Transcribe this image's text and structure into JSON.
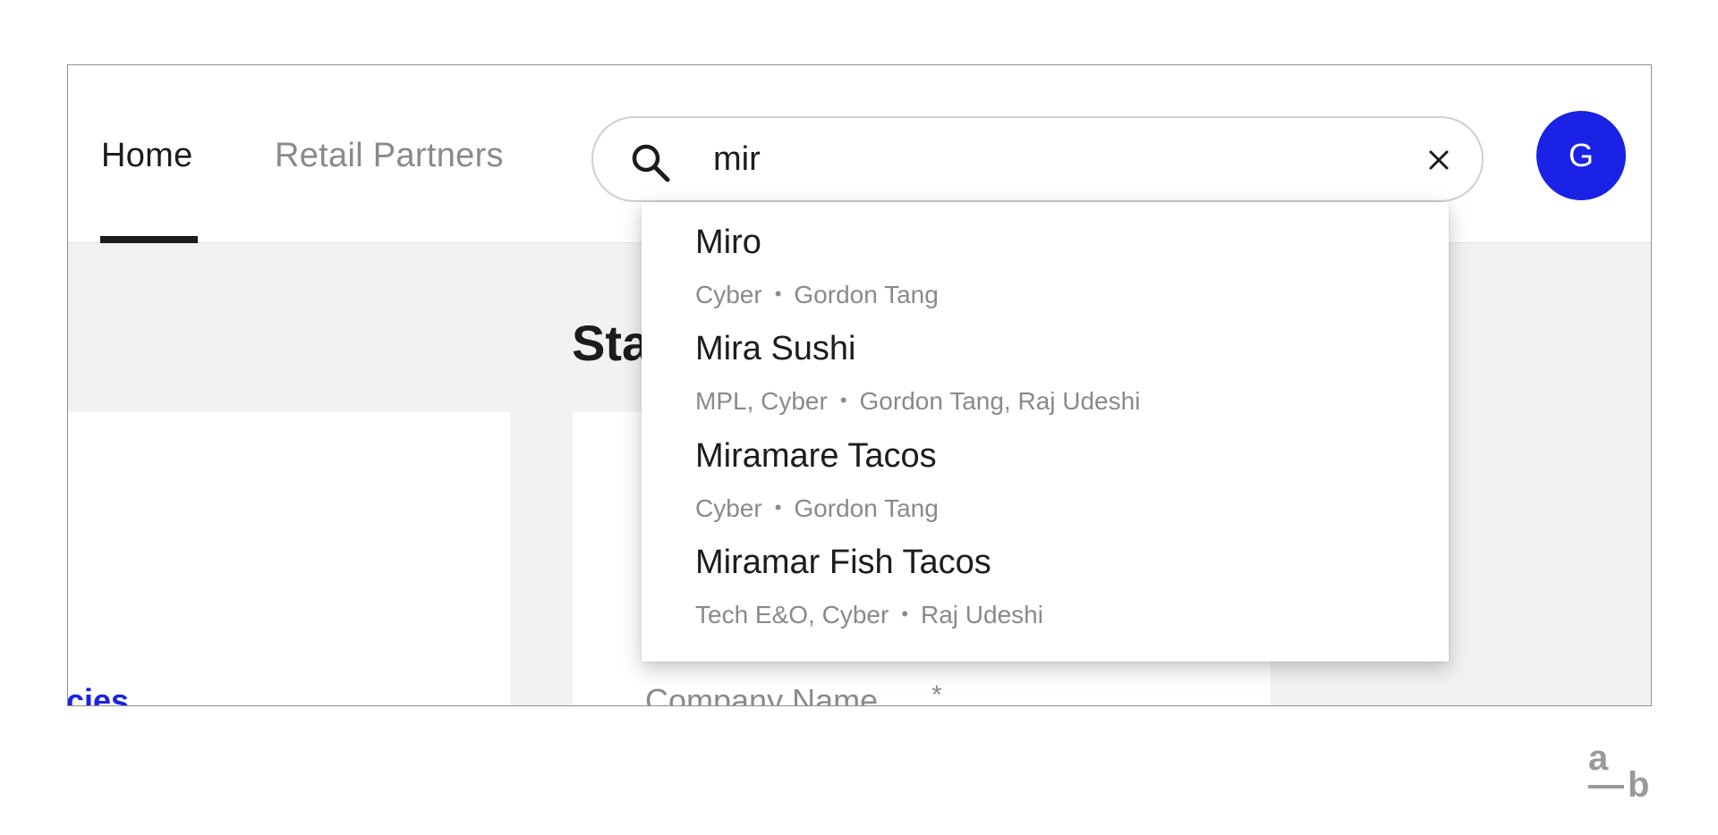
{
  "nav": {
    "tabs": [
      {
        "label": "Home",
        "active": true
      },
      {
        "label": "Retail Partners",
        "active": false
      }
    ]
  },
  "search": {
    "value": "mir",
    "icon": "search-icon",
    "clear_icon": "close-icon"
  },
  "avatar": {
    "initial": "G",
    "color": "#1a22e6"
  },
  "background": {
    "heading": "Sta",
    "policies_link": "icies",
    "form_label": "Company Name",
    "form_required": "*"
  },
  "results": [
    {
      "title": "Miro",
      "tags": "Cyber",
      "people": "Gordon Tang"
    },
    {
      "title": "Mira Sushi",
      "tags": "MPL, Cyber",
      "people": "Gordon Tang, Raj Udeshi"
    },
    {
      "title": "Miramare Tacos",
      "tags": "Cyber",
      "people": "Gordon Tang"
    },
    {
      "title": "Miramar Fish Tacos",
      "tags": "Tech E&O, Cyber",
      "people": "Raj Udeshi"
    }
  ],
  "separator": "•",
  "logo": {
    "top": "a",
    "bottom": "b"
  },
  "colors": {
    "accent": "#1a22e6",
    "text": "#1c1c1c",
    "muted": "#8a8a8a"
  }
}
